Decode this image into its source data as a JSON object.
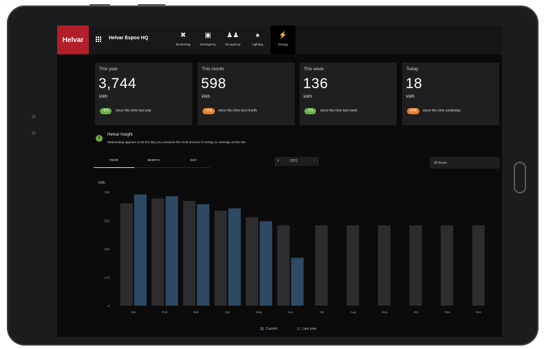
{
  "brand": {
    "name": "Helvar",
    "color": "#b21f2a"
  },
  "site": {
    "name": "Helvar Espoo HQ",
    "icon": "grid-icon"
  },
  "nav": [
    {
      "label": "Monitoring",
      "icon": "tools-icon",
      "glyph": "✖"
    },
    {
      "label": "Emergency",
      "icon": "emergency-icon",
      "glyph": "▣"
    },
    {
      "label": "Occupancy",
      "icon": "occupancy-icon",
      "glyph": "♟♟"
    },
    {
      "label": "Lighting",
      "icon": "lighting-icon",
      "glyph": "♠"
    },
    {
      "label": "Energy",
      "icon": "energy-icon",
      "glyph": "⚡",
      "active": true
    }
  ],
  "cards": [
    {
      "title": "This year",
      "value": "3,744",
      "unit": "kWh",
      "badge": "-2%",
      "badge_color": "#6cae45",
      "note": "since this time last year"
    },
    {
      "title": "This month",
      "value": "598",
      "unit": "kWh",
      "badge": "+2%",
      "badge_color": "#e9822c",
      "note": "since this time last month"
    },
    {
      "title": "This week",
      "value": "136",
      "unit": "kWh",
      "badge": "-2%",
      "badge_color": "#6cae45",
      "note": "since this time last week"
    },
    {
      "title": "Today",
      "value": "18",
      "unit": "kWh",
      "badge": "+2%",
      "badge_color": "#e9822c",
      "note": "since this time yesterday"
    }
  ],
  "insight": {
    "icon": "info-icon",
    "title": "Helvar Insight",
    "text": "Wednesday appears to be the day you consume the most amount of energy on average at this site"
  },
  "tabs": [
    "YEAR",
    "MONTH",
    "DAY"
  ],
  "active_tab": "YEAR",
  "year_picker": {
    "year": "2021",
    "prev": "‹",
    "next": "›"
  },
  "floor_select": {
    "value": "All floors"
  },
  "chart_data": {
    "type": "bar",
    "ylabel": "kWh",
    "ylim": [
      0,
      700
    ],
    "yticks": [
      "0",
      "175",
      "350",
      "525",
      "700"
    ],
    "categories": [
      "Jan",
      "Feb",
      "Mar",
      "Apr",
      "May",
      "Jun",
      "Jul",
      "Aug",
      "Sep",
      "Oct",
      "Nov",
      "Dec"
    ],
    "series": [
      {
        "name": "Current",
        "color": "#2e4a63",
        "values": [
          685,
          675,
          625,
          600,
          520,
          295,
          null,
          null,
          null,
          null,
          null,
          null
        ]
      },
      {
        "name": "Last year",
        "color": "#2d2d2f",
        "values": [
          630,
          660,
          645,
          585,
          545,
          495,
          495,
          495,
          495,
          495,
          495,
          495
        ]
      }
    ],
    "legend": [
      "Current",
      "Last year"
    ],
    "legend_position": "bottom"
  }
}
